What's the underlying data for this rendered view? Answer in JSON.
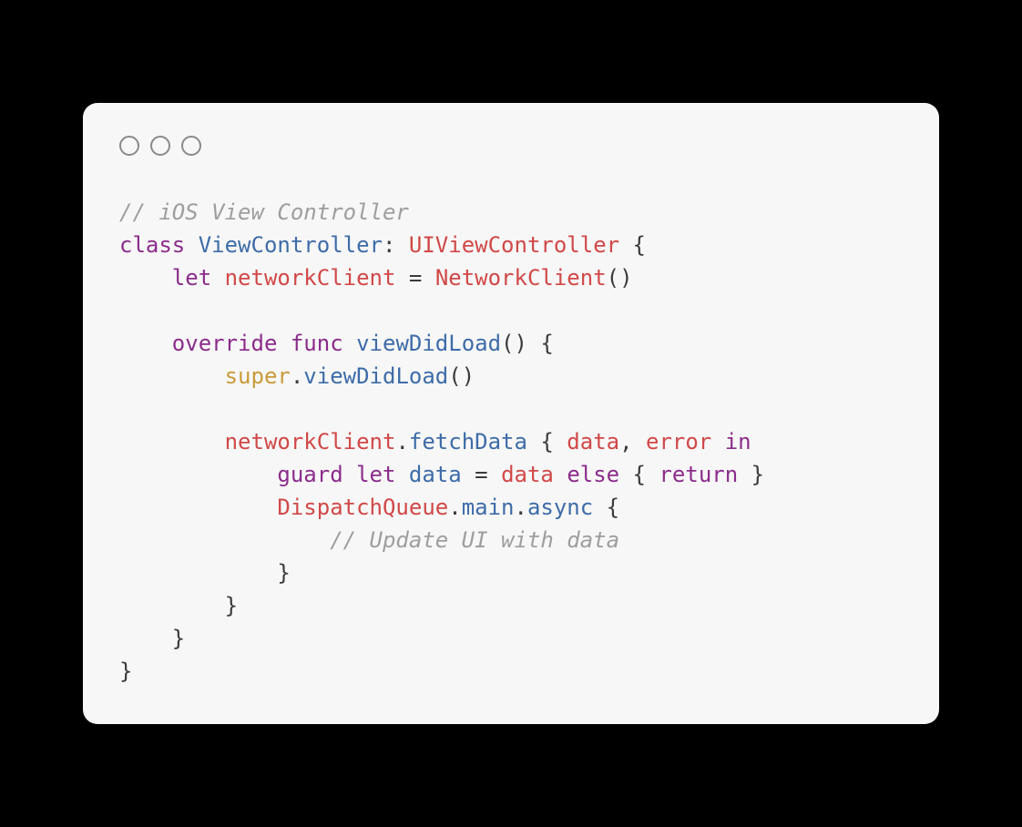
{
  "code": {
    "tokens": [
      {
        "cls": "c-comment",
        "text": "// iOS View Controller"
      },
      {
        "nl": true
      },
      {
        "cls": "c-keyword",
        "text": "class"
      },
      {
        "cls": "",
        "text": " "
      },
      {
        "cls": "c-name",
        "text": "ViewController"
      },
      {
        "cls": "c-punct",
        "text": ": "
      },
      {
        "cls": "c-type",
        "text": "UIViewController"
      },
      {
        "cls": "c-punct",
        "text": " {"
      },
      {
        "nl": true
      },
      {
        "cls": "",
        "text": "    "
      },
      {
        "cls": "c-keyword",
        "text": "let"
      },
      {
        "cls": "",
        "text": " "
      },
      {
        "cls": "c-prop",
        "text": "networkClient"
      },
      {
        "cls": "c-punct",
        "text": " = "
      },
      {
        "cls": "c-type",
        "text": "NetworkClient"
      },
      {
        "cls": "c-punct",
        "text": "()"
      },
      {
        "nl": true
      },
      {
        "nl": true
      },
      {
        "cls": "",
        "text": "    "
      },
      {
        "cls": "c-keyword",
        "text": "override"
      },
      {
        "cls": "",
        "text": " "
      },
      {
        "cls": "c-keyword",
        "text": "func"
      },
      {
        "cls": "",
        "text": " "
      },
      {
        "cls": "c-name",
        "text": "viewDidLoad"
      },
      {
        "cls": "c-punct",
        "text": "() {"
      },
      {
        "nl": true
      },
      {
        "cls": "",
        "text": "        "
      },
      {
        "cls": "c-super",
        "text": "super"
      },
      {
        "cls": "c-punct",
        "text": "."
      },
      {
        "cls": "c-name",
        "text": "viewDidLoad"
      },
      {
        "cls": "c-punct",
        "text": "()"
      },
      {
        "nl": true
      },
      {
        "nl": true
      },
      {
        "cls": "",
        "text": "        "
      },
      {
        "cls": "c-prop",
        "text": "networkClient"
      },
      {
        "cls": "c-punct",
        "text": "."
      },
      {
        "cls": "c-name",
        "text": "fetchData"
      },
      {
        "cls": "c-punct",
        "text": " { "
      },
      {
        "cls": "c-prop",
        "text": "data"
      },
      {
        "cls": "c-punct",
        "text": ", "
      },
      {
        "cls": "c-prop",
        "text": "error"
      },
      {
        "cls": "",
        "text": " "
      },
      {
        "cls": "c-keyword",
        "text": "in"
      },
      {
        "nl": true
      },
      {
        "cls": "",
        "text": "            "
      },
      {
        "cls": "c-keyword",
        "text": "guard"
      },
      {
        "cls": "",
        "text": " "
      },
      {
        "cls": "c-keyword",
        "text": "let"
      },
      {
        "cls": "",
        "text": " "
      },
      {
        "cls": "c-name",
        "text": "data"
      },
      {
        "cls": "c-punct",
        "text": " = "
      },
      {
        "cls": "c-prop",
        "text": "data"
      },
      {
        "cls": "",
        "text": " "
      },
      {
        "cls": "c-keyword",
        "text": "else"
      },
      {
        "cls": "c-punct",
        "text": " { "
      },
      {
        "cls": "c-keyword",
        "text": "return"
      },
      {
        "cls": "c-punct",
        "text": " }"
      },
      {
        "nl": true
      },
      {
        "cls": "",
        "text": "            "
      },
      {
        "cls": "c-type",
        "text": "DispatchQueue"
      },
      {
        "cls": "c-punct",
        "text": "."
      },
      {
        "cls": "c-name",
        "text": "main"
      },
      {
        "cls": "c-punct",
        "text": "."
      },
      {
        "cls": "c-name",
        "text": "async"
      },
      {
        "cls": "c-punct",
        "text": " {"
      },
      {
        "nl": true
      },
      {
        "cls": "",
        "text": "                "
      },
      {
        "cls": "c-comment",
        "text": "// Update UI with data"
      },
      {
        "nl": true
      },
      {
        "cls": "",
        "text": "            "
      },
      {
        "cls": "c-punct",
        "text": "}"
      },
      {
        "nl": true
      },
      {
        "cls": "",
        "text": "        "
      },
      {
        "cls": "c-punct",
        "text": "}"
      },
      {
        "nl": true
      },
      {
        "cls": "",
        "text": "    "
      },
      {
        "cls": "c-punct",
        "text": "}"
      },
      {
        "nl": true
      },
      {
        "cls": "c-punct",
        "text": "}"
      }
    ]
  }
}
